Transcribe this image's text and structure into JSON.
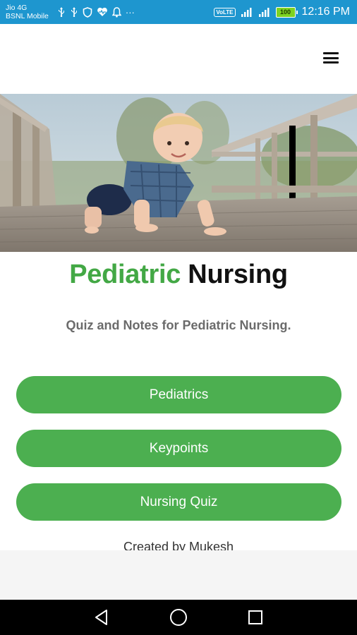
{
  "status_bar": {
    "carrier_1": "Jio 4G",
    "carrier_2": "BSNL Mobile",
    "notification_icons": [
      "usb-icon",
      "usb-icon",
      "shield-icon",
      "heart-monitor-icon",
      "bell-icon",
      "more-icon"
    ],
    "more_glyph": "···",
    "volte": "VoLTE",
    "battery": "100",
    "time": "12:16 PM"
  },
  "app": {
    "hero_image": "baby-crawling-on-wooden-bridge",
    "title_accent": "Pediatric",
    "title_main": " Nursing",
    "subtitle": "Quiz and Notes for Pediatric Nursing.",
    "buttons": [
      "Pediatrics",
      "Keypoints",
      "Nursing Quiz"
    ],
    "credit": "Created by Mukesh"
  },
  "colors": {
    "status_bar": "#1e96cf",
    "accent_green": "#43a845",
    "button_green": "#4caf50",
    "nav_bar": "#000000"
  }
}
